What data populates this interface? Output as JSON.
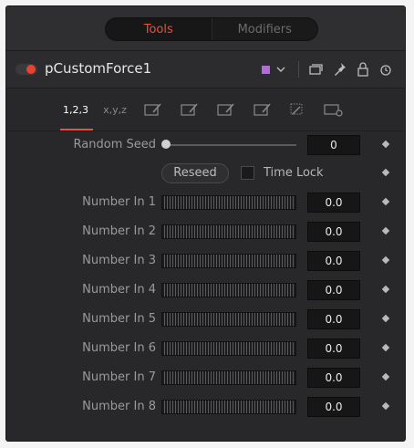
{
  "tabs": {
    "tools": "Tools",
    "modifiers": "Modifiers"
  },
  "header": {
    "tool_name": "pCustomForce1",
    "swatch_color": "#b16dd6",
    "icons": [
      "chevron-down-icon",
      "versions-icon",
      "pin-icon",
      "lock-icon",
      "reset-icon"
    ]
  },
  "icon_tabs": {
    "tab1_label": "1,2,3",
    "tab2_label": "x,y,z",
    "active_color": "#e8503c"
  },
  "random_seed": {
    "label": "Random Seed",
    "value": "0"
  },
  "reseed": {
    "label": "Reseed"
  },
  "time_lock": {
    "label": "Time Lock"
  },
  "numbers": [
    {
      "label": "Number In 1",
      "value": "0.0"
    },
    {
      "label": "Number In 2",
      "value": "0.0"
    },
    {
      "label": "Number In 3",
      "value": "0.0"
    },
    {
      "label": "Number In 4",
      "value": "0.0"
    },
    {
      "label": "Number In 5",
      "value": "0.0"
    },
    {
      "label": "Number In 6",
      "value": "0.0"
    },
    {
      "label": "Number In 7",
      "value": "0.0"
    },
    {
      "label": "Number In 8",
      "value": "0.0"
    }
  ]
}
